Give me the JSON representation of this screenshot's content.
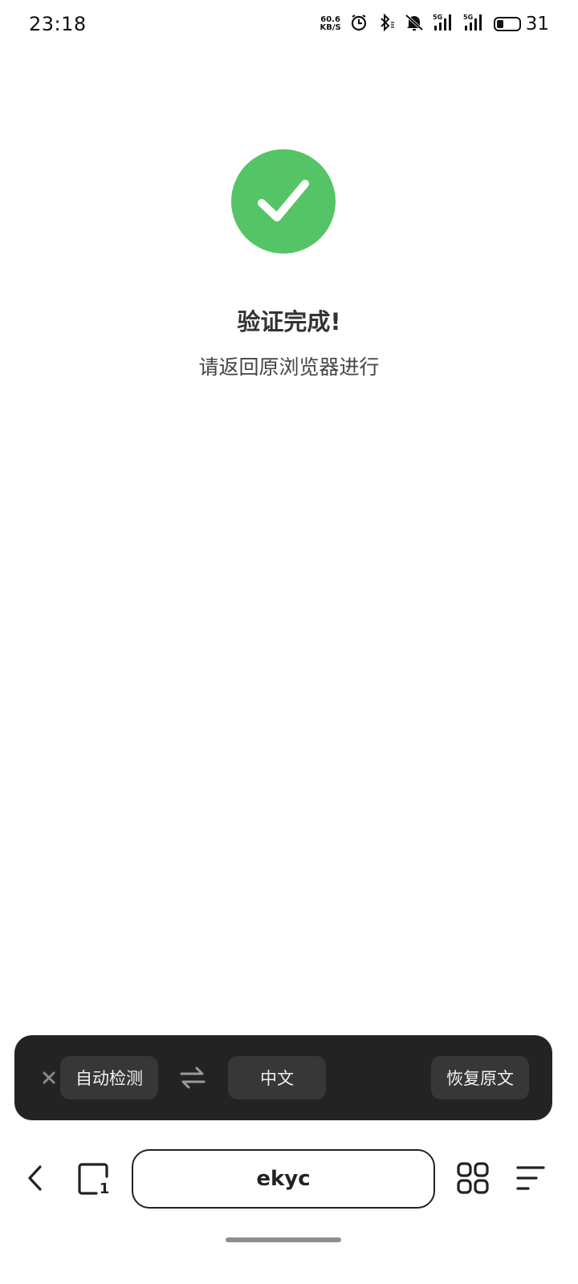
{
  "status_bar": {
    "time": "23:18",
    "net_speed_value": "60.6",
    "net_speed_unit": "KB/S",
    "signal_1_label": "5G",
    "signal_2_label": "5G",
    "battery_level": "31",
    "icons": [
      "alarm-icon",
      "bluetooth-icon",
      "mute-icon",
      "signal-icon",
      "signal-icon",
      "battery-icon"
    ]
  },
  "content": {
    "status_icon": "check-circle-icon",
    "accent_color": "#55c466",
    "title": "验证完成!",
    "subtitle": "请返回原浏览器进行"
  },
  "translate_bar": {
    "close_icon": "close-icon",
    "source_language": "自动检测",
    "swap_icon": "swap-icon",
    "target_language": "中文",
    "restore_label": "恢复原文"
  },
  "bottom_nav": {
    "back_icon": "back-icon",
    "tab_count": "1",
    "address_text": "ekyc",
    "apps_icon": "apps-grid-icon",
    "menu_icon": "menu-icon"
  }
}
